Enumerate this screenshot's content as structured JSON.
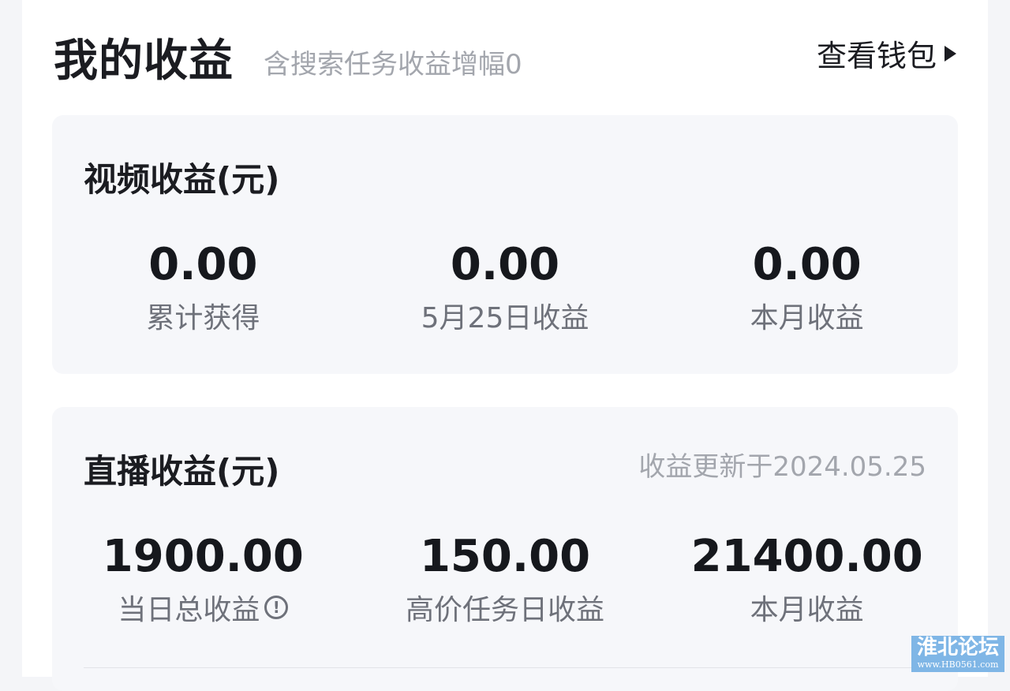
{
  "header": {
    "title": "我的收益",
    "subtitle": "含搜索任务收益增幅0",
    "wallet_link": "查看钱包",
    "wallet_icon": "caret-right-icon"
  },
  "video_card": {
    "title": "视频收益(元)",
    "stats": [
      {
        "value": "0.00",
        "label": "累计获得"
      },
      {
        "value": "0.00",
        "label": "5月25日收益"
      },
      {
        "value": "0.00",
        "label": "本月收益"
      }
    ]
  },
  "live_card": {
    "title": "直播收益(元)",
    "note": "收益更新于2024.05.25",
    "stats": [
      {
        "value": "1900.00",
        "label": "当日总收益",
        "icon": "info-icon"
      },
      {
        "value": "150.00",
        "label": "高价任务日收益"
      },
      {
        "value": "21400.00",
        "label": "本月收益"
      }
    ]
  },
  "watermark": {
    "main": "淮北论坛",
    "sub": "www.HB0561.com"
  },
  "colors": {
    "background": "#f4f5f8",
    "card": "#f6f7fa",
    "text_primary": "#16181d",
    "text_secondary": "#6e717a",
    "text_muted": "#a3a6ad",
    "watermark_bg": "#7fb6e6"
  }
}
